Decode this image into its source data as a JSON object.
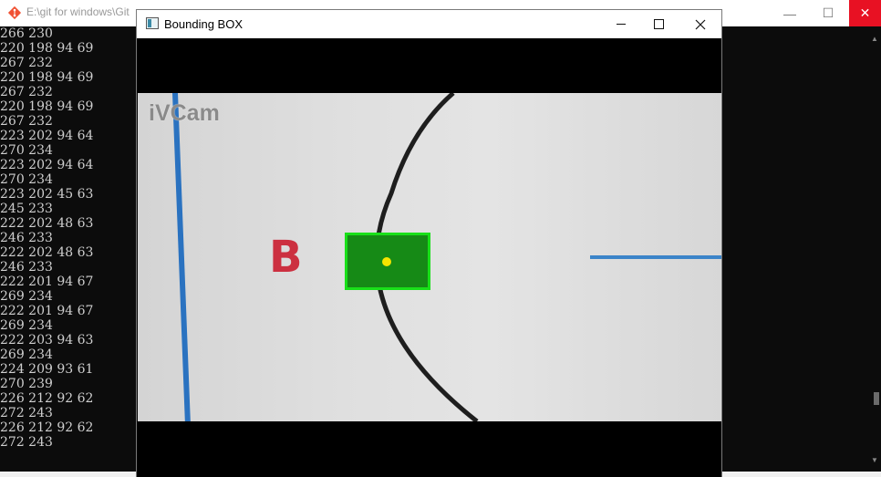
{
  "console": {
    "title": "E:\\git for windows\\Git",
    "lines": [
      "266 230",
      "220 198 94 69",
      "267 232",
      "220 198 94 69",
      "267 232",
      "220 198 94 69",
      "267 232",
      "223 202 94 64",
      "270 234",
      "223 202 94 64",
      "270 234",
      "223 202 45 63",
      "245 233",
      "222 202 48 63",
      "246 233",
      "222 202 48 63",
      "246 233",
      "222 201 94 67",
      "269 234",
      "222 201 94 67",
      "269 234",
      "222 203 94 63",
      "269 234",
      "224 209 93 61",
      "270 239",
      "226 212 92 62",
      "272 243",
      "226 212 92 62",
      "272 243"
    ]
  },
  "window": {
    "title": "Bounding BOX"
  },
  "frame": {
    "watermark": "iVCam",
    "letter": "B"
  },
  "colors": {
    "box_border": "#19e019",
    "box_fill": "#168a16",
    "center_dot": "#f5e400",
    "close_button": "#e81123"
  }
}
